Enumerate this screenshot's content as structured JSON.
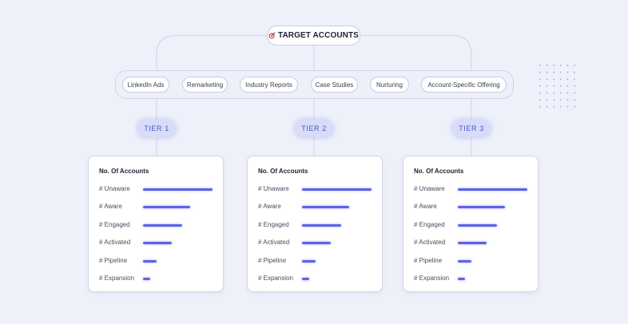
{
  "root": {
    "label": "TARGET ACCOUNTS",
    "icon": "target-icon"
  },
  "channels": [
    {
      "label": "LinkedIn Ads"
    },
    {
      "label": "Remarketing"
    },
    {
      "label": "Industry Reports"
    },
    {
      "label": "Case Studies"
    },
    {
      "label": "Nurturing"
    },
    {
      "label": "Account-Specific Offering"
    }
  ],
  "tiers": [
    {
      "label": "TIER 1",
      "card_title": "No. Of Accounts",
      "metrics": [
        {
          "label": "# Unaware",
          "value": 1.0
        },
        {
          "label": "# Aware",
          "value": 0.68
        },
        {
          "label": "# Engaged",
          "value": 0.56
        },
        {
          "label": "# Activated",
          "value": 0.41
        },
        {
          "label": "# Pipeline",
          "value": 0.19
        },
        {
          "label": "# Expansion",
          "value": 0.1
        }
      ]
    },
    {
      "label": "TIER 2",
      "card_title": "No. Of Accounts",
      "metrics": [
        {
          "label": "# Unaware",
          "value": 1.0
        },
        {
          "label": "# Aware",
          "value": 0.68
        },
        {
          "label": "# Engaged",
          "value": 0.56
        },
        {
          "label": "# Activated",
          "value": 0.41
        },
        {
          "label": "# Pipeline",
          "value": 0.19
        },
        {
          "label": "# Expansion",
          "value": 0.1
        }
      ]
    },
    {
      "label": "TIER 3",
      "card_title": "No. Of Accounts",
      "metrics": [
        {
          "label": "# Unaware",
          "value": 1.0
        },
        {
          "label": "# Aware",
          "value": 0.68
        },
        {
          "label": "# Engaged",
          "value": 0.56
        },
        {
          "label": "# Activated",
          "value": 0.41
        },
        {
          "label": "# Pipeline",
          "value": 0.19
        },
        {
          "label": "# Expansion",
          "value": 0.1
        }
      ]
    }
  ],
  "colors": {
    "accent": "#5b63e6",
    "tier_bg": "#d8dcf6",
    "background": "#eef1fa"
  }
}
